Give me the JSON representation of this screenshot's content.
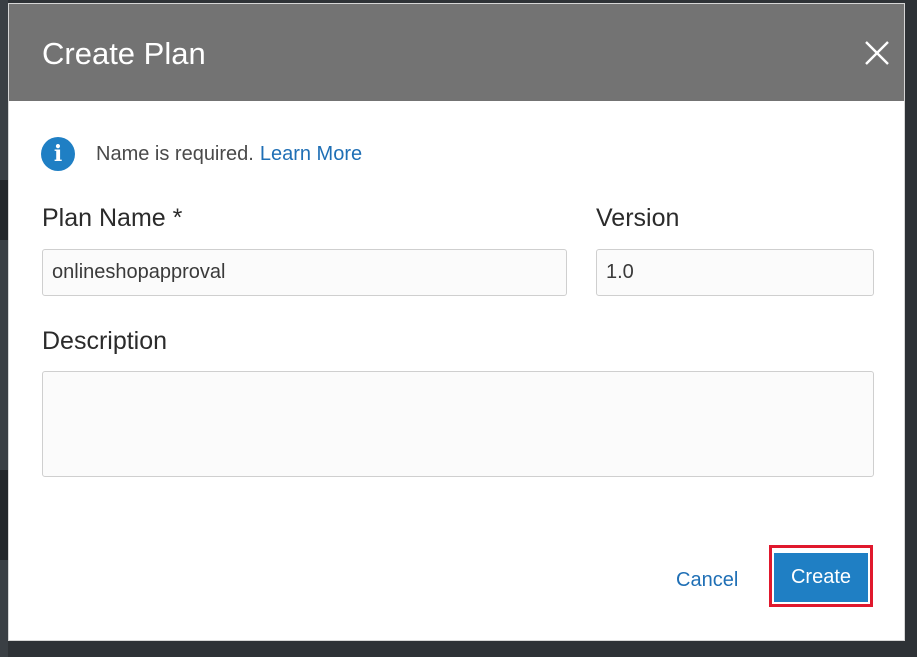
{
  "dialog": {
    "title": "Create Plan",
    "close_icon": "close-icon"
  },
  "info": {
    "icon": "info-icon",
    "message": "Name is required.",
    "link_label": "Learn More"
  },
  "form": {
    "plan_name_label": "Plan Name *",
    "plan_name_value": "onlineshopapproval",
    "version_label": "Version",
    "version_value": "1.0",
    "description_label": "Description",
    "description_value": ""
  },
  "actions": {
    "cancel_label": "Cancel",
    "create_label": "Create"
  },
  "colors": {
    "header_bg": "#737373",
    "primary": "#1f7fc4",
    "link": "#1f6fb5",
    "highlight": "#e0182d"
  }
}
